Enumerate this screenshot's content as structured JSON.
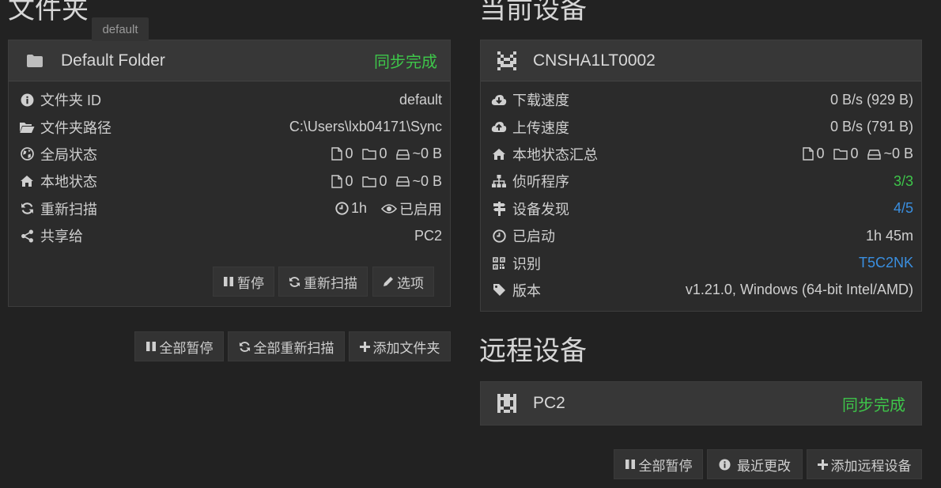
{
  "folders_section": {
    "title": "文件夹",
    "tooltip": "default",
    "folder": {
      "name": "Default Folder",
      "status": "同步完成",
      "rows": [
        {
          "label": "文件夹 ID",
          "value": "default"
        },
        {
          "label": "文件夹路径",
          "value": "C:\\Users\\lxb04171\\Sync"
        },
        {
          "label": "全局状态",
          "files": "0",
          "dirs": "0",
          "size": "~0 B"
        },
        {
          "label": "本地状态",
          "files": "0",
          "dirs": "0",
          "size": "~0 B"
        },
        {
          "label": "重新扫描",
          "interval": "1h",
          "watch": "已启用"
        },
        {
          "label": "共享给",
          "value": "PC2"
        }
      ],
      "buttons": {
        "pause": "暂停",
        "rescan": "重新扫描",
        "options": "选项"
      }
    },
    "actions": {
      "pause_all": "全部暂停",
      "rescan_all": "全部重新扫描",
      "add_folder": "添加文件夹"
    }
  },
  "this_device": {
    "title": "当前设备",
    "name": "CNSHA1LT0002",
    "rows": [
      {
        "label": "下载速度",
        "value": "0 B/s (929 B)"
      },
      {
        "label": "上传速度",
        "value": "0 B/s (791 B)"
      },
      {
        "label": "本地状态汇总",
        "files": "0",
        "dirs": "0",
        "size": "~0 B"
      },
      {
        "label": "侦听程序",
        "value": "3/3"
      },
      {
        "label": "设备发现",
        "value": "4/5"
      },
      {
        "label": "已启动",
        "value": "1h 45m"
      },
      {
        "label": "识别",
        "value": "T5C2NK"
      },
      {
        "label": "版本",
        "value": "v1.21.0, Windows (64-bit Intel/AMD)"
      }
    ]
  },
  "remote_devices": {
    "title": "远程设备",
    "device": {
      "name": "PC2",
      "status": "同步完成"
    },
    "actions": {
      "pause_all": "全部暂停",
      "recent_changes": "最近更改",
      "add_device": "添加远程设备"
    }
  },
  "colors": {
    "background": "#222222",
    "panel": "#2b2b2b",
    "synced": "#3ec64a",
    "link": "#3a8fe0"
  }
}
